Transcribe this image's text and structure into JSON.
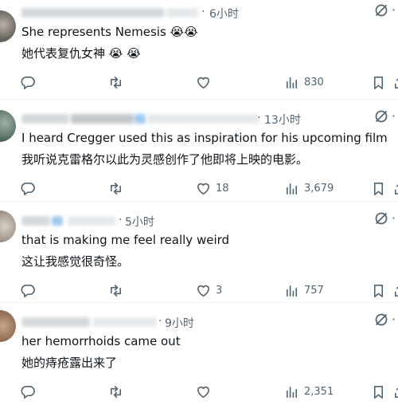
{
  "posts": [
    {
      "time": "6小时",
      "text_en": "She represents Nemesis 😭😭",
      "text_zh": "她代表复仇女神 😭 😭",
      "views": "830"
    },
    {
      "time": "13小时",
      "text_en": "I heard Cregger used this as inspiration for his upcoming film",
      "text_zh": "我听说克雷格尔以此为灵感创作了他即将上映的电影。",
      "likes": "18",
      "views": "3,679"
    },
    {
      "time": "5小时",
      "text_en": "that is making me feel really weird",
      "text_zh": "这让我感觉很奇怪。",
      "likes": "3",
      "views": "757"
    },
    {
      "time": "9小时",
      "text_en": "her hemorrhoids came out",
      "text_zh": "她的痔疮露出来了",
      "views": "2,351"
    }
  ],
  "meta_separator": "·",
  "icons": {
    "reply": "reply-icon",
    "repost": "repost-icon",
    "like": "heart-icon",
    "views": "views-chart-icon",
    "bookmark": "bookmark-icon",
    "share": "share-icon",
    "grok": "grok-icon"
  }
}
